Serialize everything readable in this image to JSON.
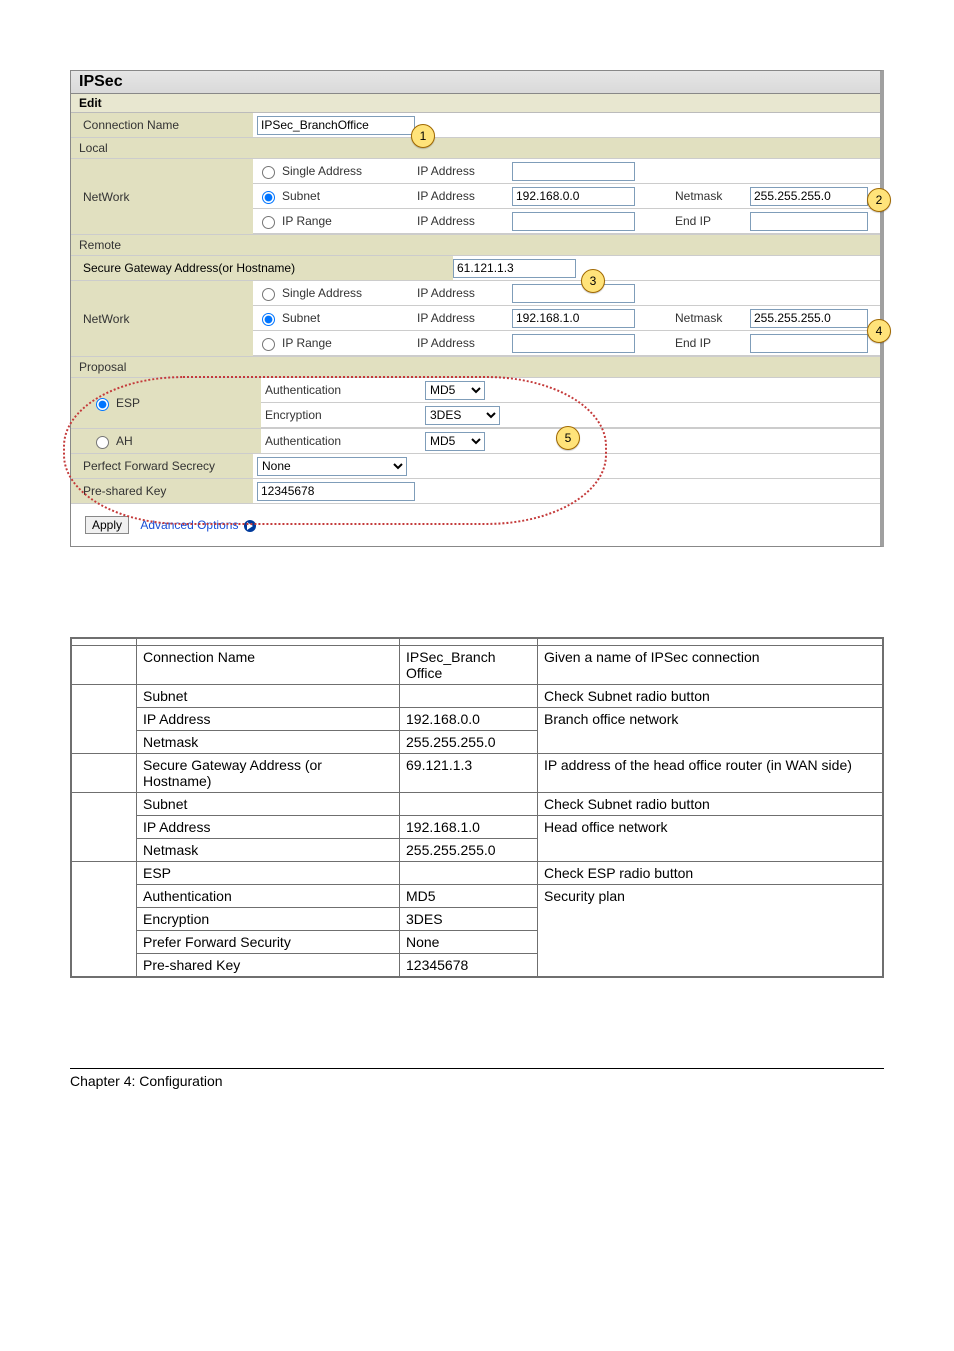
{
  "ipsec": {
    "title": "IPSec",
    "edit": "Edit",
    "conn_name_label": "Connection Name",
    "conn_name_value": "IPSec_BranchOffice",
    "local": "Local",
    "remote": "Remote",
    "network_label": "NetWork",
    "single_addr": "Single Address",
    "subnet": "Subnet",
    "ip_range": "IP Range",
    "ip_address": "IP Address",
    "netmask": "Netmask",
    "end_ip": "End IP",
    "local_subnet_ip": "192.168.0.0",
    "local_subnet_mask": "255.255.255.0",
    "remote_gw_label": "Secure Gateway Address(or Hostname)",
    "remote_gw_value": "61.121.1.3",
    "remote_subnet_ip": "192.168.1.0",
    "remote_subnet_mask": "255.255.255.0",
    "proposal": "Proposal",
    "esp": "ESP",
    "ah": "AH",
    "authentication": "Authentication",
    "encryption": "Encryption",
    "md5": "MD5",
    "threedes": "3DES",
    "pfs_label": "Perfect Forward Secrecy",
    "pfs_value": "None",
    "psk_label": "Pre-shared Key",
    "psk_value": "12345678",
    "apply": "Apply",
    "advanced": "Advanced Options",
    "callouts": {
      "c1": "1",
      "c2": "2",
      "c3": "3",
      "c4": "4",
      "c5": "5"
    }
  },
  "table": {
    "rows": [
      {
        "f": "Connection Name",
        "v": "IPSec_Branch Office",
        "d": "Given a name of IPSec connection"
      },
      {
        "f": "Subnet",
        "v": "",
        "d": "Check Subnet radio button"
      },
      {
        "f": "IP Address",
        "v": "192.168.0.0",
        "d": "Branch office network"
      },
      {
        "f": "Netmask",
        "v": "255.255.255.0",
        "d": ""
      },
      {
        "f": "Secure Gateway Address (or Hostname)",
        "v": "69.121.1.3",
        "d": "IP address of the head office router (in WAN side)"
      },
      {
        "f": "Subnet",
        "v": "",
        "d": "Check Subnet radio button"
      },
      {
        "f": "IP Address",
        "v": "192.168.1.0",
        "d": "Head office network"
      },
      {
        "f": "Netmask",
        "v": "255.255.255.0",
        "d": ""
      },
      {
        "f": "ESP",
        "v": "",
        "d": "Check ESP radio button"
      },
      {
        "f": "Authentication",
        "v": "MD5",
        "d": "Security plan"
      },
      {
        "f": "Encryption",
        "v": "3DES",
        "d": ""
      },
      {
        "f": "Prefer Forward Security",
        "v": "None",
        "d": ""
      },
      {
        "f": "Pre-shared Key",
        "v": "12345678",
        "d": ""
      }
    ]
  },
  "footer": "Chapter 4: Configuration"
}
